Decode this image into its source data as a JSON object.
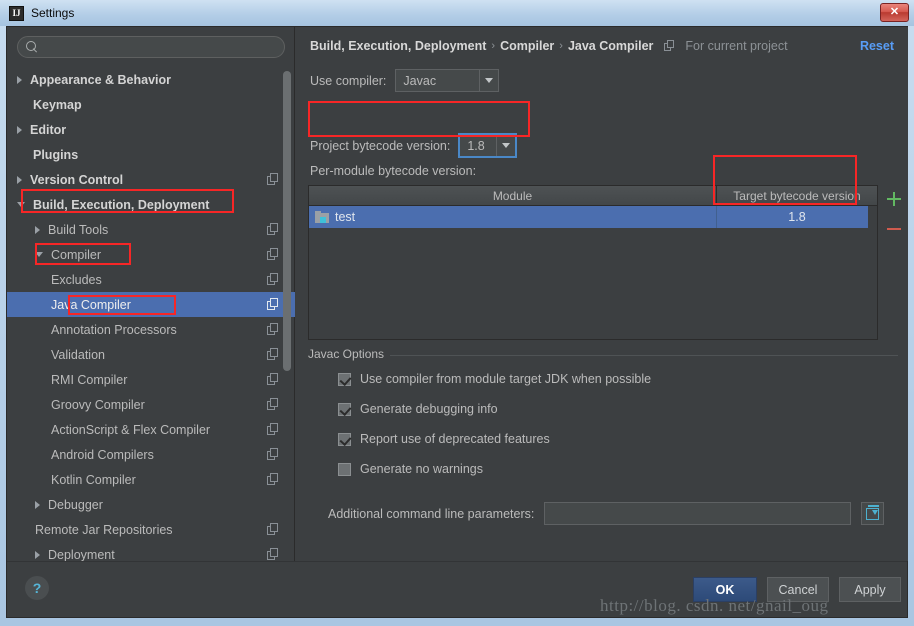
{
  "window": {
    "title": "Settings",
    "app_icon": "intellij-idea-icon",
    "close_label": "✕"
  },
  "sidebar": {
    "search": {
      "value": "",
      "placeholder": ""
    },
    "items": [
      {
        "label": "Appearance & Behavior",
        "arrow": "closed",
        "indent": 10,
        "bold": true,
        "selected": false,
        "proj_icon": false
      },
      {
        "label": "Keymap",
        "arrow": "none",
        "indent": 26,
        "bold": true,
        "selected": false,
        "proj_icon": false
      },
      {
        "label": "Editor",
        "arrow": "closed",
        "indent": 10,
        "bold": true,
        "selected": false,
        "proj_icon": false
      },
      {
        "label": "Plugins",
        "arrow": "none",
        "indent": 26,
        "bold": true,
        "selected": false,
        "proj_icon": false
      },
      {
        "label": "Version Control",
        "arrow": "closed",
        "indent": 10,
        "bold": true,
        "selected": false,
        "proj_icon": true
      },
      {
        "label": "Build, Execution, Deployment",
        "arrow": "open",
        "indent": 10,
        "bold": true,
        "selected": false,
        "proj_icon": false
      },
      {
        "label": "Build Tools",
        "arrow": "closed",
        "indent": 28,
        "bold": false,
        "selected": false,
        "proj_icon": true
      },
      {
        "label": "Compiler",
        "arrow": "open",
        "indent": 28,
        "bold": false,
        "selected": false,
        "proj_icon": true
      },
      {
        "label": "Excludes",
        "arrow": "none",
        "indent": 44,
        "bold": false,
        "selected": false,
        "proj_icon": true
      },
      {
        "label": "Java Compiler",
        "arrow": "none",
        "indent": 44,
        "bold": false,
        "selected": true,
        "proj_icon": true
      },
      {
        "label": "Annotation Processors",
        "arrow": "none",
        "indent": 44,
        "bold": false,
        "selected": false,
        "proj_icon": true
      },
      {
        "label": "Validation",
        "arrow": "none",
        "indent": 44,
        "bold": false,
        "selected": false,
        "proj_icon": true
      },
      {
        "label": "RMI Compiler",
        "arrow": "none",
        "indent": 44,
        "bold": false,
        "selected": false,
        "proj_icon": true
      },
      {
        "label": "Groovy Compiler",
        "arrow": "none",
        "indent": 44,
        "bold": false,
        "selected": false,
        "proj_icon": true
      },
      {
        "label": "ActionScript & Flex Compiler",
        "arrow": "none",
        "indent": 44,
        "bold": false,
        "selected": false,
        "proj_icon": true
      },
      {
        "label": "Android Compilers",
        "arrow": "none",
        "indent": 44,
        "bold": false,
        "selected": false,
        "proj_icon": true
      },
      {
        "label": "Kotlin Compiler",
        "arrow": "none",
        "indent": 44,
        "bold": false,
        "selected": false,
        "proj_icon": true
      },
      {
        "label": "Debugger",
        "arrow": "closed",
        "indent": 28,
        "bold": false,
        "selected": false,
        "proj_icon": false
      },
      {
        "label": "Remote Jar Repositories",
        "arrow": "none",
        "indent": 28,
        "bold": false,
        "selected": false,
        "proj_icon": true
      },
      {
        "label": "Deployment",
        "arrow": "closed",
        "indent": 28,
        "bold": false,
        "selected": false,
        "proj_icon": true
      }
    ]
  },
  "header": {
    "crumb1": "Build, Execution, Deployment",
    "sep1": "›",
    "crumb2": "Compiler",
    "sep2": "›",
    "crumb3": "Java Compiler",
    "scope": "For current project",
    "reset": "Reset"
  },
  "main": {
    "use_compiler_label": "Use compiler:",
    "use_compiler_value": "Javac",
    "project_bytecode_label": "Project bytecode version:",
    "project_bytecode_value": "1.8",
    "per_module_label": "Per-module bytecode version:",
    "table": {
      "columns": [
        "Module",
        "Target bytecode version"
      ],
      "rows": [
        {
          "module": "test",
          "target": "1.8",
          "selected": true
        }
      ],
      "add_label": "+",
      "remove_label": "−"
    },
    "javac": {
      "legend": "Javac Options",
      "checkboxes": [
        {
          "label": "Use compiler from module target JDK when possible",
          "checked": true
        },
        {
          "label": "Generate debugging info",
          "checked": true
        },
        {
          "label": "Report use of deprecated features",
          "checked": true
        },
        {
          "label": "Generate no warnings",
          "checked": false
        }
      ],
      "params_label": "Additional command line parameters:",
      "params_value": "",
      "params_placeholder": ""
    }
  },
  "footer": {
    "help": "?",
    "ok": "OK",
    "cancel": "Cancel",
    "apply": "Apply"
  },
  "watermark": "http://blog. csdn. net/gnail_oug",
  "colors": {
    "panel_bg": "#3c3f41",
    "selection_blue": "#4b6eaf",
    "accent_link": "#589df6",
    "annotation_red": "#f72626",
    "add_green": "#62b862",
    "remove_red": "#cf5b4e"
  }
}
